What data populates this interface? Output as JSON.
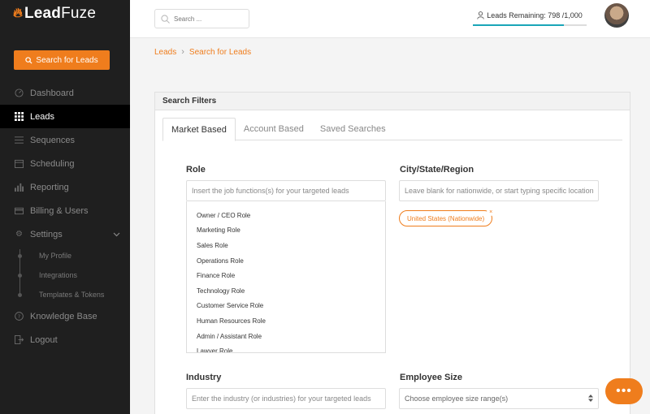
{
  "app": {
    "logo_lead": "Lead",
    "logo_fuze": "Fuze"
  },
  "sidebar": {
    "search_button": "Search for Leads",
    "items": [
      {
        "label": "Dashboard",
        "icon": "dashboard-icon"
      },
      {
        "label": "Leads",
        "icon": "grid-icon",
        "active": true
      },
      {
        "label": "Sequences",
        "icon": "list-icon"
      },
      {
        "label": "Scheduling",
        "icon": "calendar-icon"
      },
      {
        "label": "Reporting",
        "icon": "bar-chart-icon"
      },
      {
        "label": "Billing & Users",
        "icon": "card-icon"
      },
      {
        "label": "Settings",
        "icon": "gear-icon"
      }
    ],
    "settings_sub": [
      "My Profile",
      "Integrations",
      "Templates & Tokens"
    ],
    "bottom_items": [
      {
        "label": "Knowledge Base",
        "icon": "help-icon"
      },
      {
        "label": "Logout",
        "icon": "logout-icon"
      }
    ]
  },
  "header": {
    "search_placeholder": "Search ...",
    "leads_remaining": "Leads Remaining: 798 /1,000",
    "leads_progress": 0.798
  },
  "breadcrumb": {
    "root": "Leads",
    "current": "Search for Leads"
  },
  "panel": {
    "title": "Search Filters",
    "tabs": [
      "Market Based",
      "Account Based",
      "Saved Searches"
    ],
    "role": {
      "label": "Role",
      "placeholder": "Insert the job functions(s) for your targeted leads",
      "options": [
        "Owner / CEO Role",
        "Marketing Role",
        "Sales Role",
        "Operations Role",
        "Finance Role",
        "Technology Role",
        "Customer Service Role",
        "Human Resources Role",
        "Admin / Assistant Role",
        "Lawyer Role"
      ]
    },
    "city": {
      "label": "City/State/Region",
      "placeholder": "Leave blank for nationwide, or start typing specific location",
      "tag": "United States (Nationwide)",
      "tag_remove": "×"
    },
    "industry": {
      "label": "Industry",
      "placeholder": "Enter the industry (or industries) for your targeted leads"
    },
    "employee": {
      "label": "Employee Size",
      "placeholder": "Choose employee size range(s)"
    }
  },
  "chat": {
    "label": "•••"
  }
}
